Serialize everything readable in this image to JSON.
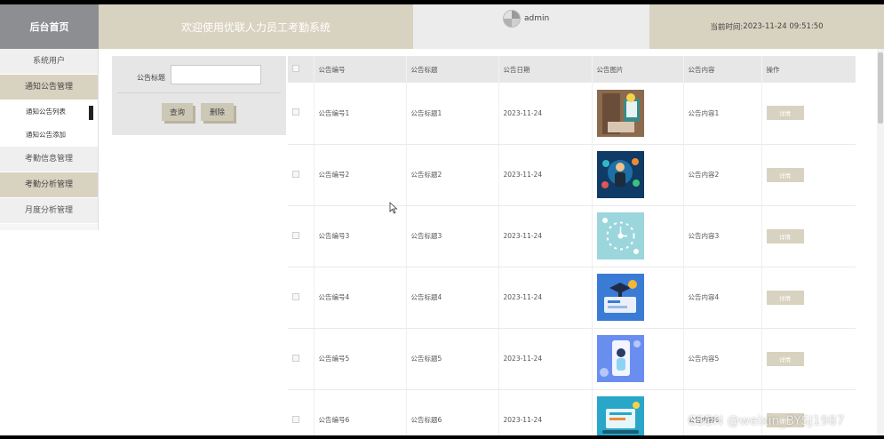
{
  "header": {
    "logo": "后台首页",
    "welcome": "欢迎使用优联人力员工考勤系统",
    "user": "admin",
    "time_label": "当前时间:",
    "time_value": "2023-11-24 09:51:50"
  },
  "sidebar": {
    "items": [
      {
        "label": "系统用户"
      },
      {
        "label": "通知公告管理"
      },
      {
        "label": "通知公告列表"
      },
      {
        "label": "通知公告添加"
      },
      {
        "label": "考勤信息管理"
      },
      {
        "label": "考勤分析管理"
      },
      {
        "label": "月度分析管理"
      }
    ]
  },
  "filter": {
    "label": "公告标题",
    "value": "",
    "search_button": "查询",
    "delete_button": "删除"
  },
  "table": {
    "headers": [
      "公告编号",
      "公告标题",
      "公告日期",
      "公告图片",
      "公告内容",
      "操作"
    ],
    "rows": [
      {
        "number": "公告编号1",
        "title": "公告标题1",
        "date": "2023-11-24",
        "content": "公告内容1",
        "action": "详情",
        "image": "office-scene-image"
      },
      {
        "number": "公告编号2",
        "title": "公告标题2",
        "date": "2023-11-24",
        "content": "公告内容2",
        "action": "详情",
        "image": "business-icons-image"
      },
      {
        "number": "公告编号3",
        "title": "公告标题3",
        "date": "2023-11-24",
        "content": "公告内容3",
        "action": "详情",
        "image": "clock-icons-image"
      },
      {
        "number": "公告编号4",
        "title": "公告标题4",
        "date": "2023-11-24",
        "content": "公告内容4",
        "action": "详情",
        "image": "education-image"
      },
      {
        "number": "公告编号5",
        "title": "公告标题5",
        "date": "2023-11-24",
        "content": "公告内容5",
        "action": "详情",
        "image": "mobile-user-image"
      },
      {
        "number": "公告编号6",
        "title": "公告标题6",
        "date": "2023-11-24",
        "content": "公告内容6",
        "action": "详情",
        "image": "online-learning-image"
      }
    ]
  },
  "watermark": "CSDN @weixin_BYSJ1987",
  "colors": {
    "accent": "#d8d2c0",
    "logo_bg": "#8c8e91",
    "header_user_bg": "#ececec"
  }
}
